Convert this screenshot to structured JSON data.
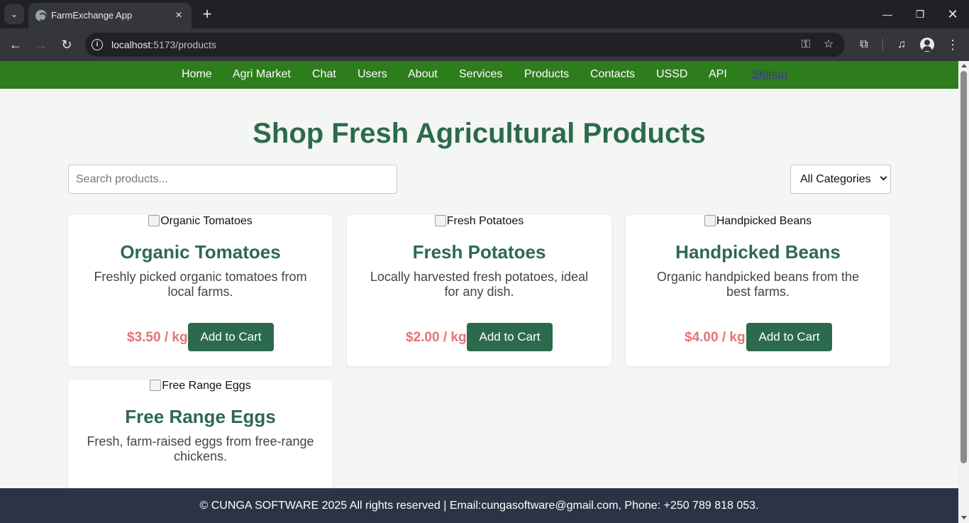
{
  "browser": {
    "tab_title": "FarmExchange App",
    "url_host": "localhost",
    "url_rest": ":5173/products",
    "icons": [
      "tab-search-icon",
      "globe-icon",
      "close-icon",
      "plus-icon",
      "minimize-icon",
      "restore-icon",
      "back-icon",
      "forward-icon",
      "reload-icon",
      "info-icon",
      "key-icon",
      "star-icon",
      "extensions-icon",
      "media-icon",
      "profile-icon",
      "more-icon"
    ]
  },
  "nav": {
    "items": [
      "Home",
      "Agri Market",
      "Chat",
      "Users",
      "About",
      "Services",
      "Products",
      "Contacts",
      "USSD",
      "API"
    ],
    "signup": "Signup"
  },
  "page": {
    "title": "Shop Fresh Agricultural Products",
    "search_placeholder": "Search products...",
    "category_selected": "All Categories"
  },
  "products": [
    {
      "alt": "Organic Tomatoes",
      "name": "Organic Tomatoes",
      "desc": "Freshly picked organic tomatoes from local farms.",
      "price": "$3.50 / kg",
      "button": "Add to Cart"
    },
    {
      "alt": "Fresh Potatoes",
      "name": "Fresh Potatoes",
      "desc": "Locally harvested fresh potatoes, ideal for any dish.",
      "price": "$2.00 / kg",
      "button": "Add to Cart"
    },
    {
      "alt": "Handpicked Beans",
      "name": "Handpicked Beans",
      "desc": "Organic handpicked beans from the best farms.",
      "price": "$4.00 / kg",
      "button": "Add to Cart"
    },
    {
      "alt": "Free Range Eggs",
      "name": "Free Range Eggs",
      "desc": "Fresh, farm-raised eggs from free-range chickens.",
      "price": "",
      "button": ""
    }
  ],
  "footer": {
    "text": "© CUNGA SOFTWARE 2025 All rights reserved | Email:cungasoftware@gmail.com, Phone: +250 789 818 053."
  },
  "colors": {
    "nav_bg": "#2e7d1d",
    "title": "#2c6a4e",
    "price": "#e57373",
    "button": "#2c6a4e",
    "footer_bg": "#2c3345"
  }
}
